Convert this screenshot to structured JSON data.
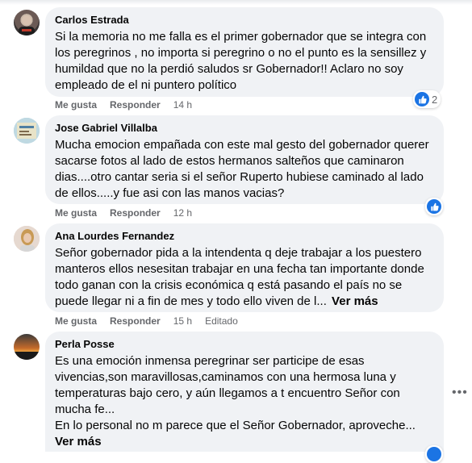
{
  "comments": [
    {
      "author": "Carlos Estrada",
      "text": "Si la memoria no me falla es el primer gobernador que se integra con los peregrinos , no importa si peregrino o no el punto es la sensillez y humildad que no la perdió saludos sr Gobernador!! Aclaro no soy empleado de el ni puntero político",
      "like_label": "Me gusta",
      "reply_label": "Responder",
      "time": "14 h",
      "reaction_count": "2"
    },
    {
      "author": "Jose Gabriel Villalba",
      "text": "Mucha emocion empañada con este mal gesto del gobernador querer sacarse fotos al lado de estos hermanos salteños que caminaron dias....otro cantar seria si el señor Ruperto hubiese caminado al lado de ellos.....y fue asi con las manos vacias?",
      "like_label": "Me gusta",
      "reply_label": "Responder",
      "time": "12 h"
    },
    {
      "author": "Ana Lourdes Fernandez",
      "text": "Señor gobernador pida a la intendenta q deje trabajar a los puestero manteros ellos nesesitan trabajar en una fecha tan importante donde todo ganan con la crisis económica q está pasando el país no se puede llegar ni a fin de mes y todo ello viven de l...",
      "see_more": "Ver más",
      "like_label": "Me gusta",
      "reply_label": "Responder",
      "time": "15 h",
      "edited": "Editado"
    },
    {
      "author": "Perla Posse",
      "text_lines": [
        "Es una emoción inmensa peregrinar ser participe de esas",
        "vivencias,son maravillosas,caminamos con una hermosa luna y",
        "temperaturas bajo cero, y aún llegamos a t encuentro Señor con",
        "mucha fe...",
        "En lo personal no m parece que el Señor Gobernador, aproveche..."
      ],
      "see_more": "Ver más"
    }
  ],
  "icons": {
    "like": "thumbs-up-icon",
    "options": "more-options-icon"
  },
  "colors": {
    "bubble": "#f0f2f5",
    "accent": "#1b74e4",
    "secondary_text": "#65676b"
  }
}
